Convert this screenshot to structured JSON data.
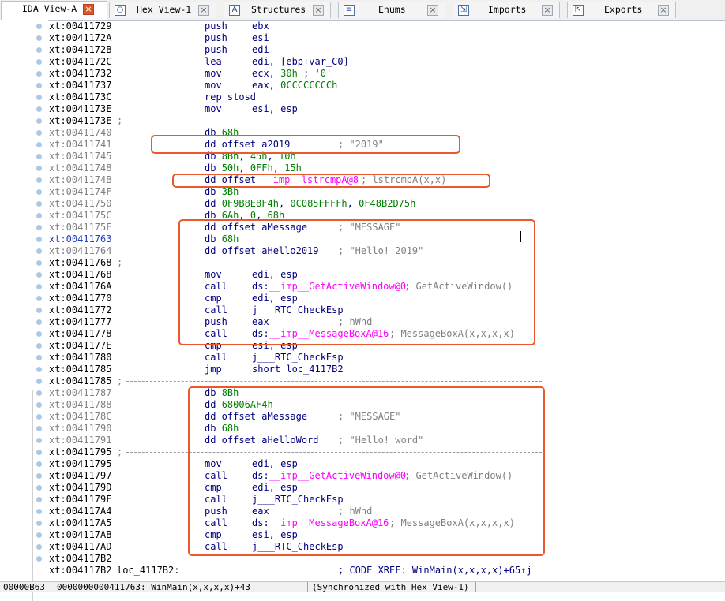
{
  "tabs": [
    {
      "label": "IDA View-A",
      "icon": "ida-view-icon",
      "active": true
    },
    {
      "label": "Hex View-1",
      "icon": "hex-view-icon",
      "active": false
    },
    {
      "label": "Structures",
      "icon": "structures-icon",
      "active": false
    },
    {
      "label": "Enums",
      "icon": "enums-icon",
      "active": false
    },
    {
      "label": "Imports",
      "icon": "imports-icon",
      "active": false
    },
    {
      "label": "Exports",
      "icon": "exports-icon",
      "active": false
    }
  ],
  "lines": [
    {
      "addr": "xt:00411729",
      "addr_style": "normal",
      "mnem": "push",
      "op": "ebx"
    },
    {
      "addr": "xt:0041172A",
      "addr_style": "normal",
      "mnem": "push",
      "op": "esi"
    },
    {
      "addr": "xt:0041172B",
      "addr_style": "normal",
      "mnem": "push",
      "op": "edi"
    },
    {
      "addr": "xt:0041172C",
      "addr_style": "normal",
      "mnem": "lea",
      "op": "edi, [ebp+var_C0]"
    },
    {
      "addr": "xt:00411732",
      "addr_style": "normal",
      "mnem": "mov",
      "op": "ecx, 30h ; '0'"
    },
    {
      "addr": "xt:00411737",
      "addr_style": "normal",
      "mnem": "mov",
      "op": "eax, 0CCCCCCCCh"
    },
    {
      "addr": "xt:0041173C",
      "addr_style": "normal",
      "mnem": "rep stosd",
      "op": ""
    },
    {
      "addr": "xt:0041173E",
      "addr_style": "normal",
      "mnem": "mov",
      "op": "esi, esp"
    },
    {
      "addr": "xt:0041173E",
      "addr_style": "normal",
      "separator": true
    },
    {
      "addr": "xt:00411740",
      "addr_style": "gray",
      "mnem": "db 68h",
      "op": ""
    },
    {
      "addr": "xt:00411741",
      "addr_style": "gray",
      "mnem": "dd offset a2019",
      "op": "",
      "comment": "; \"2019\"",
      "comment_col": 366
    },
    {
      "addr": "xt:00411745",
      "addr_style": "gray",
      "mnem": "db 8Bh, 45h, 10h",
      "op": ""
    },
    {
      "addr": "xt:00411748",
      "addr_style": "gray",
      "mnem": "db 50h, 0FFh, 15h",
      "op": ""
    },
    {
      "addr": "xt:0041174B",
      "addr_style": "gray",
      "mnem": "dd offset __imp__lstrcmpA@8",
      "op": "",
      "comment": "; lstrcmpA(x,x)",
      "comment_col": 395
    },
    {
      "addr": "xt:0041174F",
      "addr_style": "gray",
      "mnem": "db 3Bh",
      "op": ""
    },
    {
      "addr": "xt:00411750",
      "addr_style": "gray",
      "mnem": "dd 0F9B8E8F4h, 0C085FFFFh, 0F48B2D75h",
      "op": ""
    },
    {
      "addr": "xt:0041175C",
      "addr_style": "gray",
      "mnem": "db 6Ah, 0, 68h",
      "op": ""
    },
    {
      "addr": "xt:0041175F",
      "addr_style": "gray",
      "mnem": "dd offset aMessage",
      "op": "",
      "comment": "; \"MESSAGE\"",
      "comment_col": 366
    },
    {
      "addr": "xt:00411763",
      "addr_style": "blue",
      "mnem": "db 68h",
      "op": ""
    },
    {
      "addr": "xt:00411764",
      "addr_style": "gray",
      "mnem": "dd offset aHello2019",
      "op": "",
      "comment": "; \"Hello! 2019\"",
      "comment_col": 366
    },
    {
      "addr": "xt:00411768",
      "addr_style": "normal",
      "separator": true
    },
    {
      "addr": "xt:00411768",
      "addr_style": "normal",
      "mnem": "mov",
      "op": "edi, esp"
    },
    {
      "addr": "xt:0041176A",
      "addr_style": "normal",
      "mnem": "call",
      "op": "ds:__imp__GetActiveWindow@0",
      "comment": "; GetActiveWindow()",
      "comment_col": 450
    },
    {
      "addr": "xt:00411770",
      "addr_style": "normal",
      "mnem": "cmp",
      "op": "edi, esp"
    },
    {
      "addr": "xt:00411772",
      "addr_style": "normal",
      "mnem": "call",
      "op": "j___RTC_CheckEsp"
    },
    {
      "addr": "xt:00411777",
      "addr_style": "normal",
      "mnem": "push",
      "op": "eax",
      "comment": "; hWnd",
      "comment_col": 366
    },
    {
      "addr": "xt:00411778",
      "addr_style": "normal",
      "mnem": "call",
      "op": "ds:__imp__MessageBoxA@16",
      "comment": "; MessageBoxA(x,x,x,x)",
      "comment_col": 431
    },
    {
      "addr": "xt:0041177E",
      "addr_style": "normal",
      "mnem": "cmp",
      "op": "esi, esp"
    },
    {
      "addr": "xt:00411780",
      "addr_style": "normal",
      "mnem": "call",
      "op": "j___RTC_CheckEsp"
    },
    {
      "addr": "xt:00411785",
      "addr_style": "normal",
      "mnem": "jmp",
      "op": "short loc_4117B2"
    },
    {
      "addr": "xt:00411785",
      "addr_style": "normal",
      "separator": true
    },
    {
      "addr": "xt:00411787",
      "addr_style": "gray",
      "mnem": "db 8Bh",
      "op": ""
    },
    {
      "addr": "xt:00411788",
      "addr_style": "gray",
      "mnem": "dd 68006AF4h",
      "op": ""
    },
    {
      "addr": "xt:0041178C",
      "addr_style": "gray",
      "mnem": "dd offset aMessage",
      "op": "",
      "comment": "; \"MESSAGE\"",
      "comment_col": 366
    },
    {
      "addr": "xt:00411790",
      "addr_style": "gray",
      "mnem": "db 68h",
      "op": ""
    },
    {
      "addr": "xt:00411791",
      "addr_style": "gray",
      "mnem": "dd offset aHelloWord",
      "op": "",
      "comment": "; \"Hello! word\"",
      "comment_col": 366
    },
    {
      "addr": "xt:00411795",
      "addr_style": "normal",
      "separator": true
    },
    {
      "addr": "xt:00411795",
      "addr_style": "normal",
      "mnem": "mov",
      "op": "edi, esp"
    },
    {
      "addr": "xt:00411797",
      "addr_style": "normal",
      "mnem": "call",
      "op": "ds:__imp__GetActiveWindow@0",
      "comment": "; GetActiveWindow()",
      "comment_col": 450
    },
    {
      "addr": "xt:0041179D",
      "addr_style": "normal",
      "mnem": "cmp",
      "op": "edi, esp"
    },
    {
      "addr": "xt:0041179F",
      "addr_style": "normal",
      "mnem": "call",
      "op": "j___RTC_CheckEsp"
    },
    {
      "addr": "xt:004117A4",
      "addr_style": "normal",
      "mnem": "push",
      "op": "eax",
      "comment": "; hWnd",
      "comment_col": 366
    },
    {
      "addr": "xt:004117A5",
      "addr_style": "normal",
      "mnem": "call",
      "op": "ds:__imp__MessageBoxA@16",
      "comment": "; MessageBoxA(x,x,x,x)",
      "comment_col": 431
    },
    {
      "addr": "xt:004117AB",
      "addr_style": "normal",
      "mnem": "cmp",
      "op": "esi, esp"
    },
    {
      "addr": "xt:004117AD",
      "addr_style": "normal",
      "mnem": "call",
      "op": "j___RTC_CheckEsp"
    },
    {
      "addr": "xt:004117B2",
      "addr_style": "normal",
      "mnem": "",
      "op": ""
    },
    {
      "addr": "xt:004117B2",
      "addr_style": "normal",
      "mnem": "loc_4117B2:",
      "op": "",
      "label": true,
      "comment": "; CODE XREF: WinMain(x,x,x,x)+65↑j",
      "comment_col": 366
    }
  ],
  "status": {
    "offset": "00000B63",
    "location": "0000000000411763: WinMain(x,x,x,x)+43",
    "sync": "(Synchronized with Hex View-1)"
  },
  "colors": {
    "highlight_box": "#e85a2e",
    "import_name": "#ff00ff",
    "number": "#007f00",
    "mnemonic": "#00007f"
  }
}
